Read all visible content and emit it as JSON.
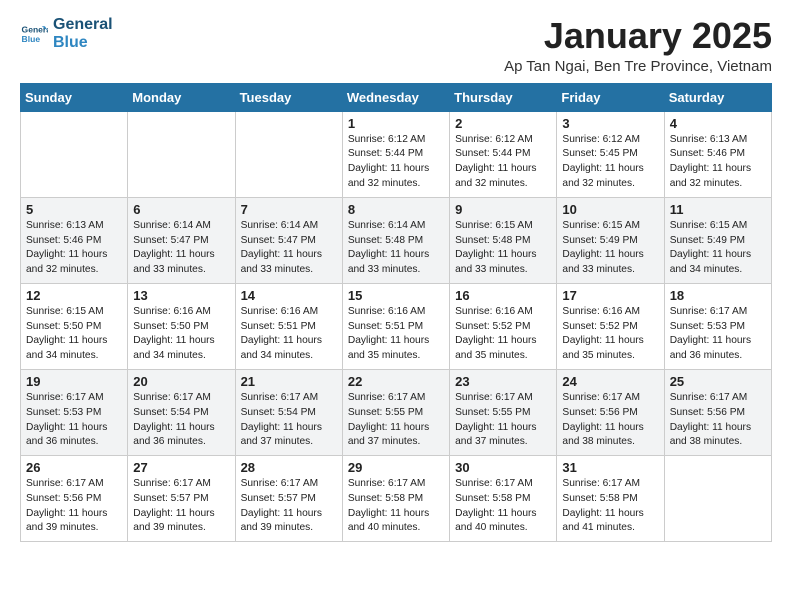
{
  "header": {
    "logo_general": "General",
    "logo_blue": "Blue",
    "month_title": "January 2025",
    "location": "Ap Tan Ngai, Ben Tre Province, Vietnam"
  },
  "days_of_week": [
    "Sunday",
    "Monday",
    "Tuesday",
    "Wednesday",
    "Thursday",
    "Friday",
    "Saturday"
  ],
  "weeks": [
    [
      {
        "day": "",
        "info": ""
      },
      {
        "day": "",
        "info": ""
      },
      {
        "day": "",
        "info": ""
      },
      {
        "day": "1",
        "info": "Sunrise: 6:12 AM\nSunset: 5:44 PM\nDaylight: 11 hours and 32 minutes."
      },
      {
        "day": "2",
        "info": "Sunrise: 6:12 AM\nSunset: 5:44 PM\nDaylight: 11 hours and 32 minutes."
      },
      {
        "day": "3",
        "info": "Sunrise: 6:12 AM\nSunset: 5:45 PM\nDaylight: 11 hours and 32 minutes."
      },
      {
        "day": "4",
        "info": "Sunrise: 6:13 AM\nSunset: 5:46 PM\nDaylight: 11 hours and 32 minutes."
      }
    ],
    [
      {
        "day": "5",
        "info": "Sunrise: 6:13 AM\nSunset: 5:46 PM\nDaylight: 11 hours and 32 minutes."
      },
      {
        "day": "6",
        "info": "Sunrise: 6:14 AM\nSunset: 5:47 PM\nDaylight: 11 hours and 33 minutes."
      },
      {
        "day": "7",
        "info": "Sunrise: 6:14 AM\nSunset: 5:47 PM\nDaylight: 11 hours and 33 minutes."
      },
      {
        "day": "8",
        "info": "Sunrise: 6:14 AM\nSunset: 5:48 PM\nDaylight: 11 hours and 33 minutes."
      },
      {
        "day": "9",
        "info": "Sunrise: 6:15 AM\nSunset: 5:48 PM\nDaylight: 11 hours and 33 minutes."
      },
      {
        "day": "10",
        "info": "Sunrise: 6:15 AM\nSunset: 5:49 PM\nDaylight: 11 hours and 33 minutes."
      },
      {
        "day": "11",
        "info": "Sunrise: 6:15 AM\nSunset: 5:49 PM\nDaylight: 11 hours and 34 minutes."
      }
    ],
    [
      {
        "day": "12",
        "info": "Sunrise: 6:15 AM\nSunset: 5:50 PM\nDaylight: 11 hours and 34 minutes."
      },
      {
        "day": "13",
        "info": "Sunrise: 6:16 AM\nSunset: 5:50 PM\nDaylight: 11 hours and 34 minutes."
      },
      {
        "day": "14",
        "info": "Sunrise: 6:16 AM\nSunset: 5:51 PM\nDaylight: 11 hours and 34 minutes."
      },
      {
        "day": "15",
        "info": "Sunrise: 6:16 AM\nSunset: 5:51 PM\nDaylight: 11 hours and 35 minutes."
      },
      {
        "day": "16",
        "info": "Sunrise: 6:16 AM\nSunset: 5:52 PM\nDaylight: 11 hours and 35 minutes."
      },
      {
        "day": "17",
        "info": "Sunrise: 6:16 AM\nSunset: 5:52 PM\nDaylight: 11 hours and 35 minutes."
      },
      {
        "day": "18",
        "info": "Sunrise: 6:17 AM\nSunset: 5:53 PM\nDaylight: 11 hours and 36 minutes."
      }
    ],
    [
      {
        "day": "19",
        "info": "Sunrise: 6:17 AM\nSunset: 5:53 PM\nDaylight: 11 hours and 36 minutes."
      },
      {
        "day": "20",
        "info": "Sunrise: 6:17 AM\nSunset: 5:54 PM\nDaylight: 11 hours and 36 minutes."
      },
      {
        "day": "21",
        "info": "Sunrise: 6:17 AM\nSunset: 5:54 PM\nDaylight: 11 hours and 37 minutes."
      },
      {
        "day": "22",
        "info": "Sunrise: 6:17 AM\nSunset: 5:55 PM\nDaylight: 11 hours and 37 minutes."
      },
      {
        "day": "23",
        "info": "Sunrise: 6:17 AM\nSunset: 5:55 PM\nDaylight: 11 hours and 37 minutes."
      },
      {
        "day": "24",
        "info": "Sunrise: 6:17 AM\nSunset: 5:56 PM\nDaylight: 11 hours and 38 minutes."
      },
      {
        "day": "25",
        "info": "Sunrise: 6:17 AM\nSunset: 5:56 PM\nDaylight: 11 hours and 38 minutes."
      }
    ],
    [
      {
        "day": "26",
        "info": "Sunrise: 6:17 AM\nSunset: 5:56 PM\nDaylight: 11 hours and 39 minutes."
      },
      {
        "day": "27",
        "info": "Sunrise: 6:17 AM\nSunset: 5:57 PM\nDaylight: 11 hours and 39 minutes."
      },
      {
        "day": "28",
        "info": "Sunrise: 6:17 AM\nSunset: 5:57 PM\nDaylight: 11 hours and 39 minutes."
      },
      {
        "day": "29",
        "info": "Sunrise: 6:17 AM\nSunset: 5:58 PM\nDaylight: 11 hours and 40 minutes."
      },
      {
        "day": "30",
        "info": "Sunrise: 6:17 AM\nSunset: 5:58 PM\nDaylight: 11 hours and 40 minutes."
      },
      {
        "day": "31",
        "info": "Sunrise: 6:17 AM\nSunset: 5:58 PM\nDaylight: 11 hours and 41 minutes."
      },
      {
        "day": "",
        "info": ""
      }
    ]
  ]
}
